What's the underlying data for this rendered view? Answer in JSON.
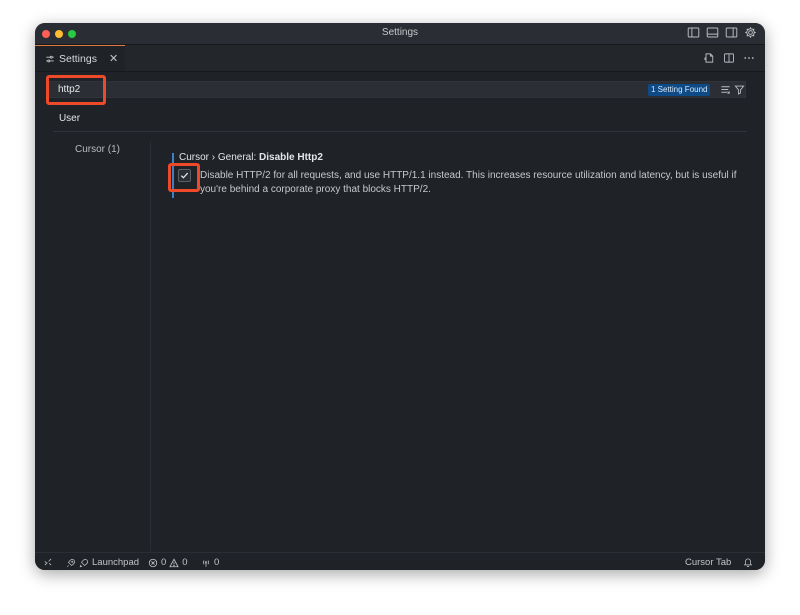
{
  "window": {
    "title": "Settings"
  },
  "tab": {
    "label": "Settings",
    "icon": "settings-sliders-icon",
    "close_glyph": "✕"
  },
  "search": {
    "value": "http2",
    "placeholder": "",
    "result_badge": "1 Setting Found"
  },
  "scope_tabs": [
    {
      "label": "User",
      "active": true
    }
  ],
  "toc": {
    "items": [
      {
        "label": "Cursor (1)"
      }
    ]
  },
  "setting": {
    "category": "Cursor › General: ",
    "name": "Disable Http2",
    "checked": true,
    "description": "Disable HTTP/2 for all requests, and use HTTP/1.1 instead. This increases resource utilization and latency, but is useful if you're behind a corporate proxy that blocks HTTP/2."
  },
  "statusbar": {
    "launchpad": "Launchpad",
    "errors": "0",
    "warnings": "0",
    "ports": "0",
    "right_label": "Cursor Tab"
  },
  "colors": {
    "accent": "#e07a3e",
    "highlight": "#ee4a2a",
    "badge": "#0d4a86",
    "background": "#1f2227"
  }
}
